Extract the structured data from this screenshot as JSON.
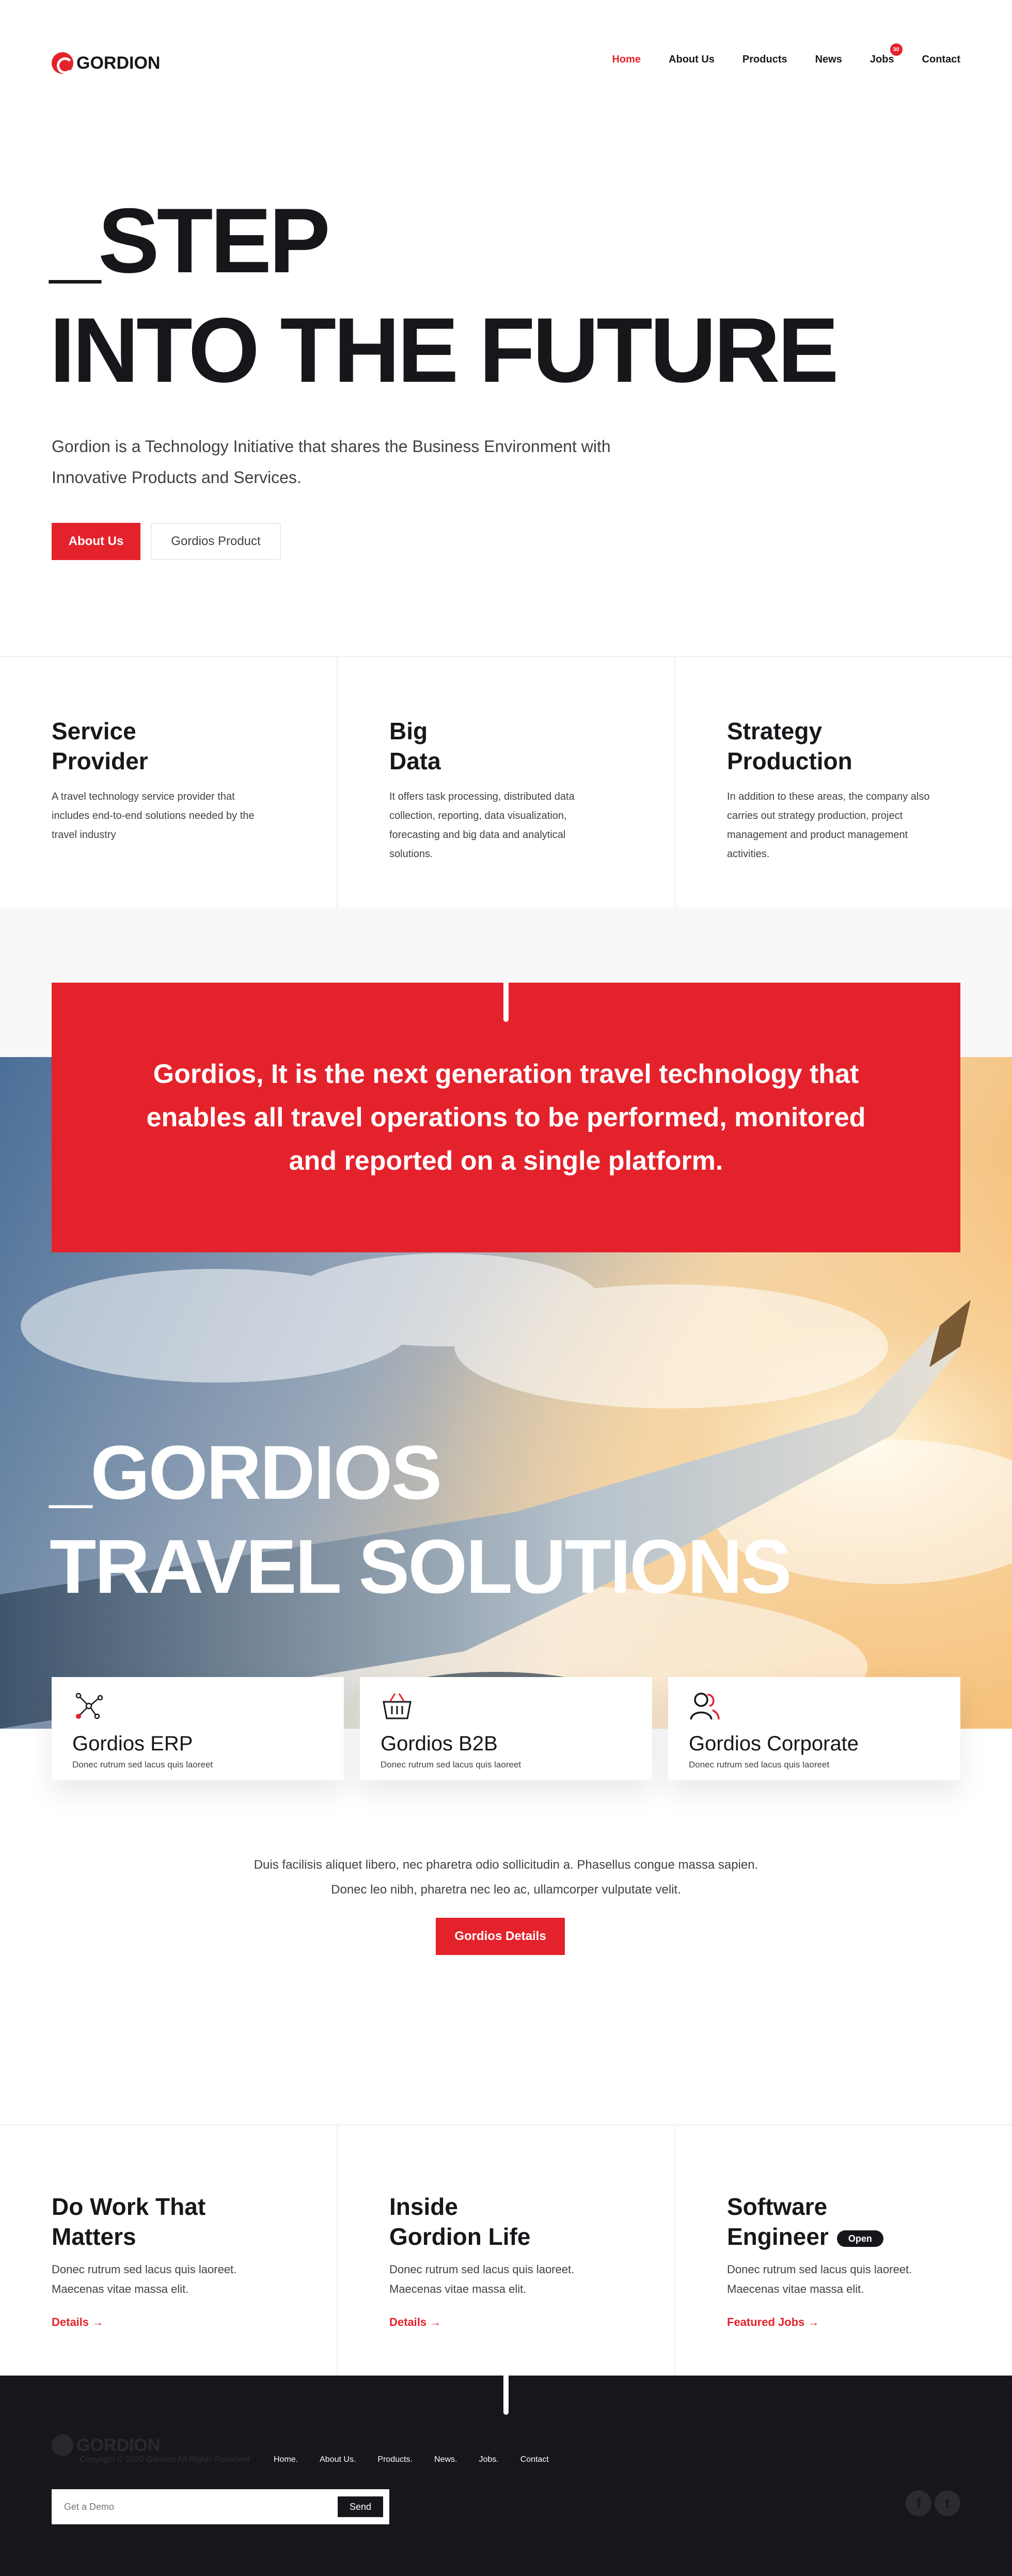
{
  "brand": {
    "name": "GORDION"
  },
  "nav": {
    "items": [
      "Home",
      "About Us",
      "Products",
      "News",
      "Jobs",
      "Contact"
    ],
    "active": "Home",
    "jobs_badge": "30"
  },
  "hero": {
    "title_line1": "_STEP",
    "title_line2": "INTO THE FUTURE",
    "description": "Gordion is a Technology Initiative that shares the Business Environment with Innovative Products and Services.",
    "primary_button": "About Us",
    "secondary_button": "Gordios Product"
  },
  "features": [
    {
      "title_line1": "Service",
      "title_line2": "Provider",
      "text": "A travel technology service provider that includes end-to-end solutions needed by the travel industry"
    },
    {
      "title_line1": "Big",
      "title_line2": "Data",
      "text": "It offers task processing, distributed data collection, reporting, data visualization, forecasting and big data and analytical solutions."
    },
    {
      "title_line1": "Strategy",
      "title_line2": "Production",
      "text": "In addition to these areas, the company also carries out strategy production, project management and product management activities."
    }
  ],
  "quote": "Gordios, It is the next generation travel technology that enables all travel operations to be performed, monitored and reported on a single platform.",
  "banner": {
    "title_line1": "_GORDIOS",
    "title_line2": "TRAVEL SOLUTIONS"
  },
  "products": [
    {
      "icon": "network-icon",
      "title": "Gordios ERP",
      "text": "Donec rutrum sed lacus quis laoreet"
    },
    {
      "icon": "basket-icon",
      "title": "Gordios B2B",
      "text": "Donec rutrum sed lacus quis laoreet"
    },
    {
      "icon": "users-icon",
      "title": "Gordios Corporate",
      "text": "Donec rutrum sed lacus quis laoreet"
    }
  ],
  "intro": {
    "line1": "Duis facilisis aliquet libero, nec pharetra odio sollicitudin a. Phasellus congue massa sapien.",
    "line2": "Donec leo nibh, pharetra nec leo ac, ullamcorper vulputate velit.",
    "button": "Gordios Details"
  },
  "columns": [
    {
      "title_line1": "Do Work That",
      "title_line2": "Matters",
      "badge": "",
      "text": "Donec rutrum sed lacus quis laoreet. Maecenas vitae massa elit.",
      "link": "Details"
    },
    {
      "title_line1": "Inside",
      "title_line2": "Gordion Life",
      "badge": "",
      "text": "Donec rutrum sed lacus quis laoreet. Maecenas vitae massa elit.",
      "link": "Details"
    },
    {
      "title_line1": "Software",
      "title_line2": "Engineer",
      "badge": "Open",
      "text": "Donec rutrum sed lacus quis laoreet. Maecenas vitae massa elit.",
      "link": "Featured Jobs"
    }
  ],
  "footer": {
    "brand": "GORDION",
    "copyright": "Copyright © 2020 Gordion All Rights Reserved",
    "nav": [
      "Home.",
      "About Us.",
      "Products.",
      "News.",
      "Jobs.",
      "Contact"
    ],
    "demo_placeholder": "Get a Demo",
    "send_button": "Send",
    "social": [
      "facebook-icon",
      "twitter-icon"
    ]
  },
  "colors": {
    "accent": "#e4222c",
    "dark": "#16171a",
    "text": "#3f4147"
  }
}
